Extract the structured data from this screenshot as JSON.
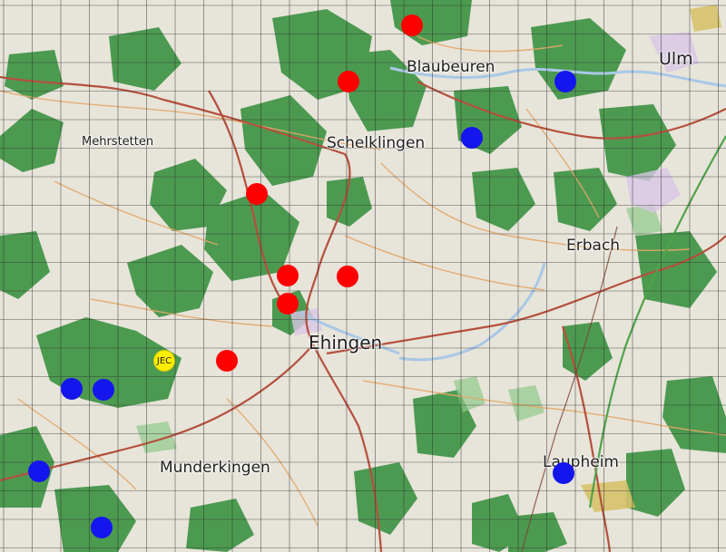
{
  "places": [
    {
      "id": "ulm",
      "name": "Ulm"
    },
    {
      "id": "blaubeuren",
      "name": "Blaubeuren"
    },
    {
      "id": "mehrstetten",
      "name": "Mehrstetten"
    },
    {
      "id": "schelklingen",
      "name": "Schelklingen"
    },
    {
      "id": "erbach",
      "name": "Erbach"
    },
    {
      "id": "ehingen",
      "name": "Ehingen"
    },
    {
      "id": "munderkingen",
      "name": "Munderkingen"
    },
    {
      "id": "laupheim",
      "name": "Laupheim"
    }
  ],
  "markers": {
    "red_color": "#ff0000",
    "blue_color": "#1515ee",
    "yellow_color": "#ffee00",
    "yellow_label": "JEC"
  },
  "colors": {
    "forest": "#3f9445",
    "forest_light": "#8fc98a",
    "road_major": "#b5503d",
    "road_minor": "#e3a86a",
    "water": "#a9c8e6",
    "grid": "#2a2a2a",
    "land": "#e7e4da"
  }
}
